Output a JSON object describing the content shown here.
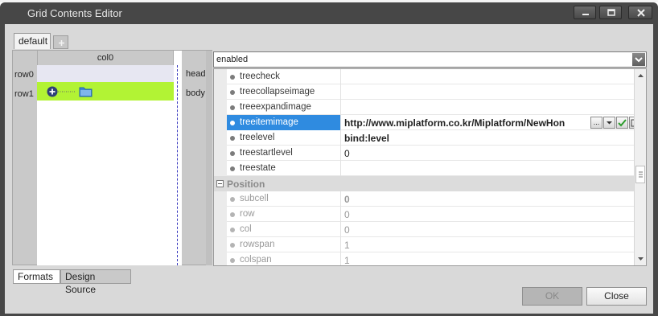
{
  "window": {
    "title": "Grid Contents Editor"
  },
  "format_tabs": {
    "active": "default",
    "add_label": "+"
  },
  "grid_design": {
    "column_header": "col0",
    "rows": [
      "row0",
      "row1"
    ],
    "band_labels": [
      "head",
      "body"
    ]
  },
  "property_combo": {
    "value": "enabled"
  },
  "properties": [
    {
      "name": "treecheck",
      "value": "",
      "bold": false,
      "disabled": false,
      "selected": false
    },
    {
      "name": "treecollapseimage",
      "value": "",
      "bold": false,
      "disabled": false,
      "selected": false
    },
    {
      "name": "treeexpandimage",
      "value": "",
      "bold": false,
      "disabled": false,
      "selected": false
    },
    {
      "name": "treeitemimage",
      "value": "http://www.miplatform.co.kr/Miplatform/NewHon",
      "bold": true,
      "disabled": false,
      "selected": true
    },
    {
      "name": "treelevel",
      "value": "bind:level",
      "bold": true,
      "disabled": false,
      "selected": false
    },
    {
      "name": "treestartlevel",
      "value": "0",
      "bold": false,
      "disabled": false,
      "selected": false
    },
    {
      "name": "treestate",
      "value": "",
      "bold": false,
      "disabled": false,
      "selected": false
    }
  ],
  "category": {
    "label": "Position"
  },
  "position_properties": [
    {
      "name": "subcell",
      "value": "0",
      "bold": true,
      "disabled": true
    },
    {
      "name": "row",
      "value": "0",
      "bold": false,
      "disabled": true
    },
    {
      "name": "col",
      "value": "0",
      "bold": false,
      "disabled": true
    },
    {
      "name": "rowspan",
      "value": "1",
      "bold": false,
      "disabled": true
    },
    {
      "name": "colspan",
      "value": "1",
      "bold": false,
      "disabled": true
    }
  ],
  "value_buttons": {
    "ellipsis": "..."
  },
  "bottom_tabs": {
    "formats": "Formats",
    "design_source": "Design Source"
  },
  "buttons": {
    "ok": "OK",
    "close": "Close"
  },
  "icons": {
    "minimize": "minimize-icon",
    "maximize": "maximize-icon",
    "close": "close-icon",
    "tree_expand": "plus-circle-icon",
    "folder": "folder-icon",
    "dropdown": "chevron-down-icon",
    "apply": "checkmark-icon",
    "edit": "edit-icon"
  },
  "colors": {
    "title_bar": "#474747",
    "selected_row": "#2f8be0",
    "body_row": "#b2f334",
    "head_row": "#e7e7f2"
  }
}
